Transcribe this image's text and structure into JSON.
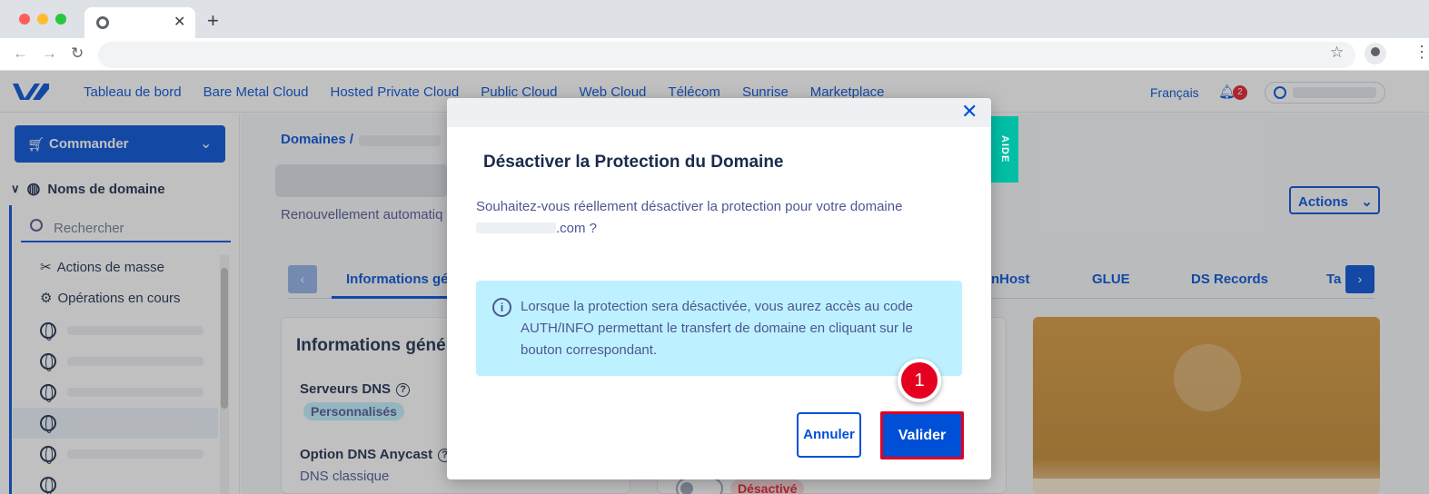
{
  "browser": {
    "tab_close_glyph": "✕",
    "new_tab_glyph": "+"
  },
  "header": {
    "nav": [
      "Tableau de bord",
      "Bare Metal Cloud",
      "Hosted Private Cloud",
      "Public Cloud",
      "Web Cloud",
      "Télécom",
      "Sunrise",
      "Marketplace"
    ],
    "language": "Français",
    "notifications_count": "2"
  },
  "sidebar": {
    "order_label": "Commander",
    "section_title": "Noms de domaine",
    "search_placeholder": "Rechercher",
    "items": [
      "Actions de masse",
      "Opérations en cours"
    ]
  },
  "main": {
    "breadcrumb": "Domaines /",
    "renew_text": "Renouvellement automatiq",
    "actions_label": "Actions",
    "tabs": [
      "Informations gén",
      "nHost",
      "GLUE",
      "DS Records",
      "Ta"
    ],
    "card_title": "Informations génér",
    "dns_servers_label": "Serveurs DNS",
    "dns_servers_badge": "Personnalisés",
    "anycast_label": "Option DNS Anycast",
    "anycast_value": "DNS classique",
    "status_badge": "Désactivé"
  },
  "help_tab": "AIDE",
  "modal": {
    "close_glyph": "✕",
    "title": "Désactiver la Protection du Domaine",
    "question": "Souhaitez-vous réellement désactiver la protection pour votre domaine",
    "domain_suffix": ".com ?",
    "info_text": "Lorsque la protection sera désactivée, vous aurez accès au code AUTH/INFO permettant le transfert de domaine en cliquant sur le bouton correspondant.",
    "cancel_label": "Annuler",
    "confirm_label": "Valider"
  },
  "annotation": {
    "step_number": "1"
  },
  "colors": {
    "brand_blue": "#0050d7",
    "info_bg": "#bef1ff",
    "highlight_red": "#e5001f",
    "help_teal": "#00bfa6"
  },
  "icons": [
    "chrome-icon",
    "back-icon",
    "forward-icon",
    "reload-icon",
    "star-icon",
    "profile-icon",
    "bell-icon",
    "cart-icon",
    "globe-icon",
    "search-icon",
    "info-icon",
    "close-icon"
  ]
}
